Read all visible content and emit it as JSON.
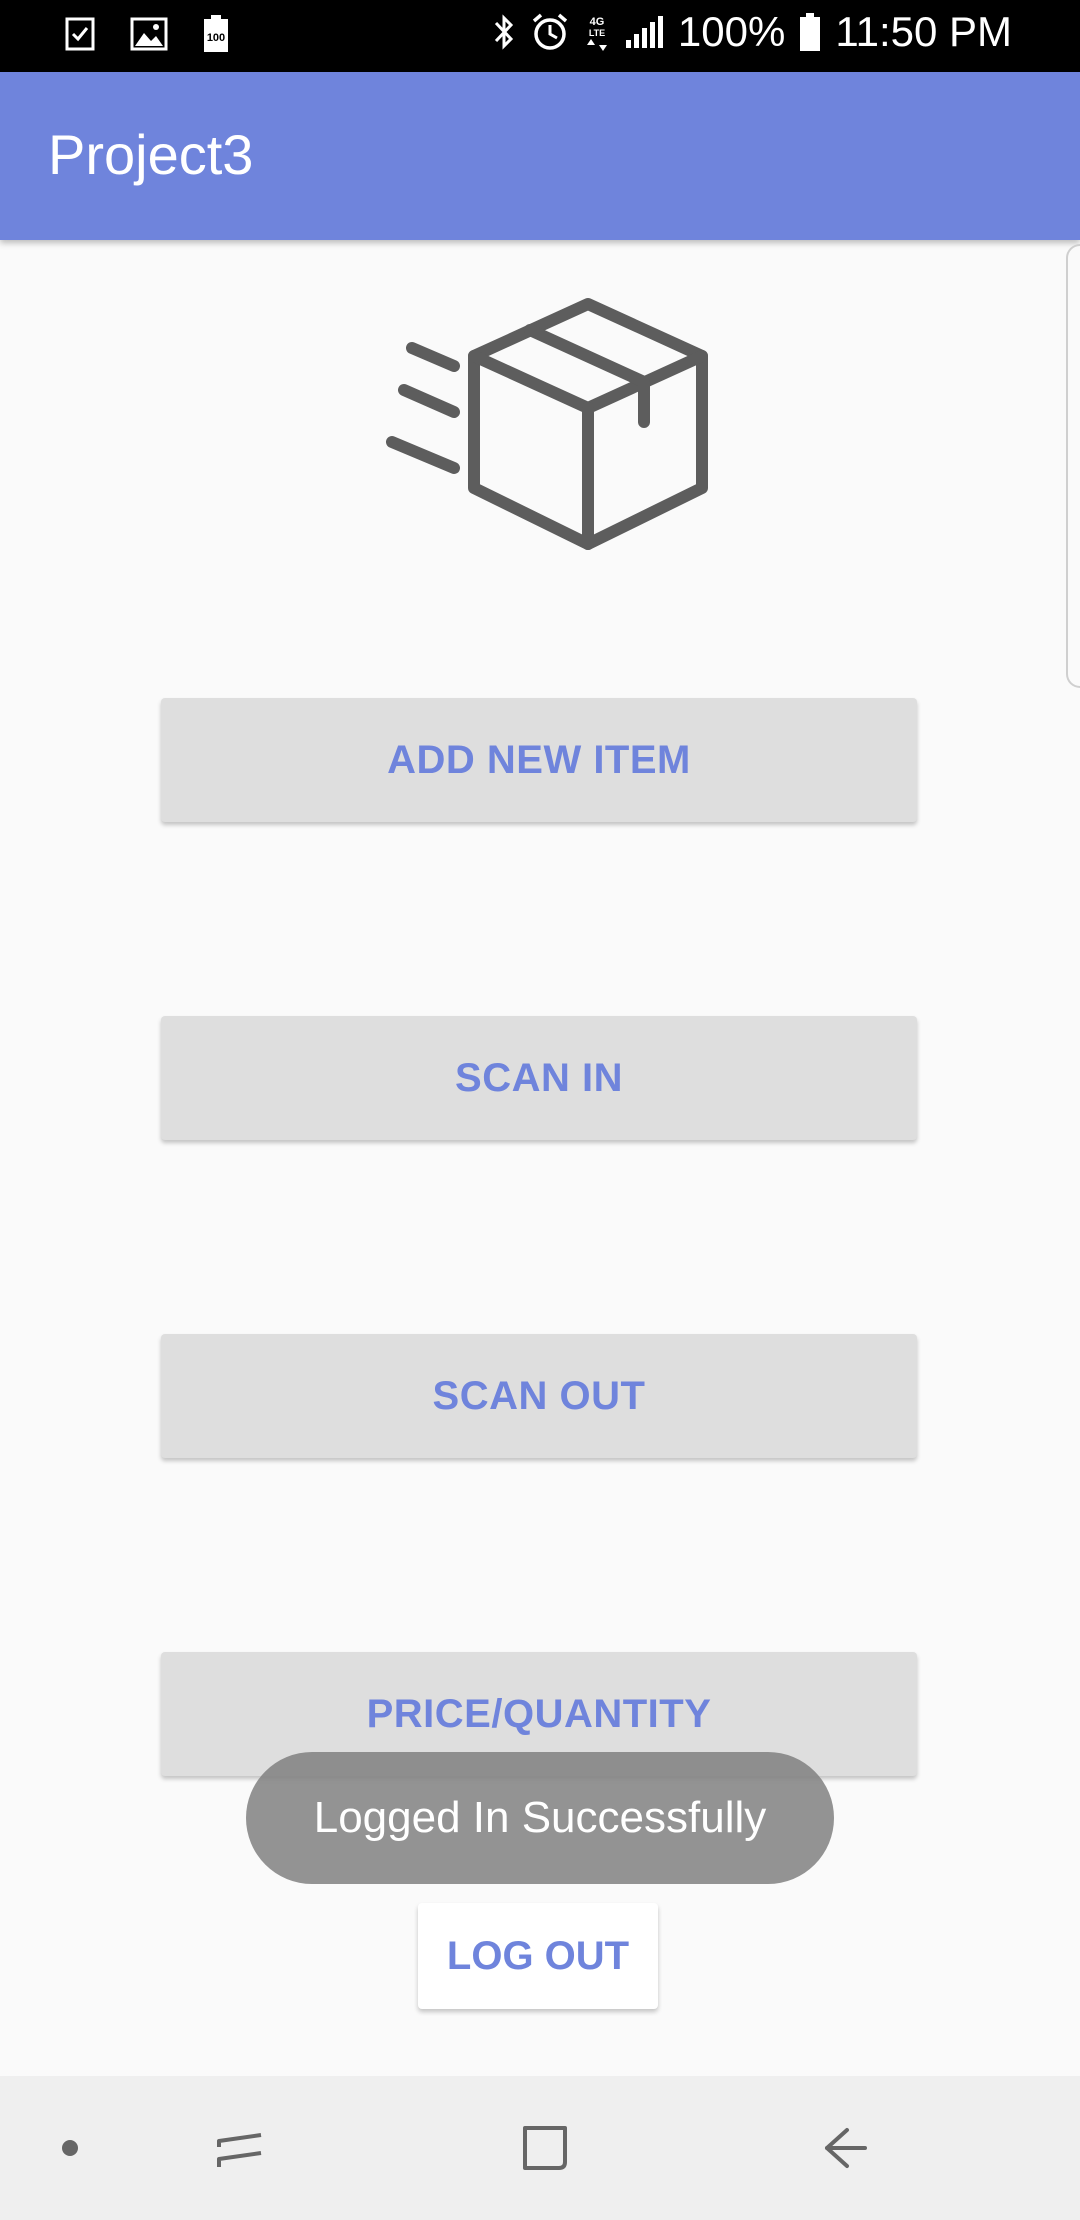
{
  "status_bar": {
    "icons_left": [
      "task-check-icon",
      "image-icon",
      "battery-saver-icon"
    ],
    "icons_right": [
      "bluetooth-icon",
      "alarm-icon",
      "lte-data-icon",
      "signal-icon",
      "battery-icon"
    ],
    "battery_percent": "100%",
    "time": "11:50 PM",
    "battery_badge": "100"
  },
  "app_bar": {
    "title": "Project3",
    "color": "#6f84dc"
  },
  "hero": {
    "icon": "fast-delivery-box-icon"
  },
  "buttons": {
    "add_new_item": "ADD NEW ITEM",
    "scan_in": "SCAN IN",
    "scan_out": "SCAN OUT",
    "price_quantity": "PRICE/QUANTITY",
    "log_out": "LOG OUT"
  },
  "toast": {
    "message": "Logged In Successfully"
  },
  "nav_bar": {
    "items": [
      "dot-icon",
      "recent-apps-icon",
      "home-icon",
      "back-icon"
    ]
  }
}
